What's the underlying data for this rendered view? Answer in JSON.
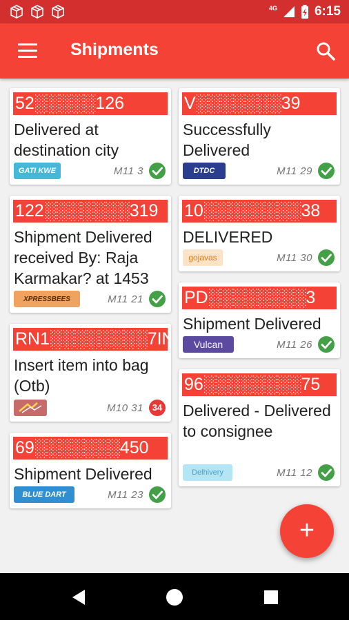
{
  "status_bar": {
    "icons": [
      "package-icon",
      "package-icon",
      "package-icon"
    ],
    "network": "4G",
    "time": "6:15"
  },
  "app_bar": {
    "title": "Shipments",
    "menu_icon": "menu-icon",
    "search_icon": "search-icon"
  },
  "left_cards": [
    {
      "number": "52░░░░░126",
      "status": "Delivered at destination city",
      "courier": "GATI KWE",
      "date": "M11 3",
      "indicator": "check"
    },
    {
      "number": "122░░░░░░░319",
      "status": "Shipment Delivered received By: Raja Karmakar? at 1453",
      "courier": "XPRESSBEES",
      "date": "M11 21",
      "indicator": "check"
    },
    {
      "number": "RN1░░░░░░░░7IN",
      "status": "Insert item into bag (Otb)",
      "courier": "",
      "date": "M10 31",
      "indicator": "badge",
      "badge": "34"
    },
    {
      "number": "69░░░░░░░450",
      "status": "Shipment Delivered",
      "courier": "BLUE DART",
      "date": "M11 23",
      "indicator": "check"
    }
  ],
  "right_cards": [
    {
      "number": "V░░░░░░░39",
      "status": "Successfully Delivered",
      "courier": "DTDC",
      "date": "M11 29",
      "indicator": "check"
    },
    {
      "number": "10░░░░░░░░38",
      "status": "DELIVERED",
      "courier": "gojavas",
      "date": "M11 30",
      "indicator": "check"
    },
    {
      "number": "PD░░░░░░░░3",
      "status": "Shipment Delivered",
      "courier": "Vulcan",
      "date": "M11 26",
      "indicator": "check"
    },
    {
      "number": "96░░░░░░░░75",
      "status": "Delivered - Delivered to consignee",
      "courier": "Delhivery",
      "date": "M11 12",
      "indicator": "check"
    }
  ],
  "fab": {
    "label": "+"
  },
  "nav": {
    "back": "back-icon",
    "home": "home-icon",
    "recents": "recents-icon"
  },
  "colors": {
    "primary": "#f44336",
    "status_bar": "#d32f2f",
    "success": "#43a047",
    "badge": "#e53935"
  }
}
